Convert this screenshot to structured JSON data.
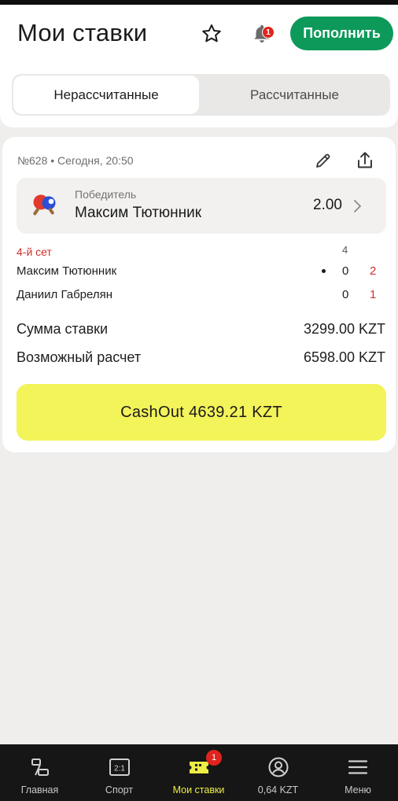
{
  "header": {
    "title": "Мои ставки",
    "notification_count": "1",
    "topup_label": "Пополнить",
    "icons": [
      "star-icon",
      "bell-icon"
    ]
  },
  "tabs": [
    {
      "label": "Нерассчитанные",
      "active": true
    },
    {
      "label": "Рассчитанные",
      "active": false
    }
  ],
  "bet": {
    "meta": "№628 • Сегодня, 20:50",
    "selection": {
      "market": "Победитель",
      "name": "Максим Тютюнник",
      "odds": "2.00",
      "sport_icon": "table-tennis-icon"
    },
    "score": {
      "set_label": "4-й сет",
      "column_header": "4",
      "rows": [
        {
          "player": "Максим Тютюнник",
          "current": "0",
          "sets": "2",
          "serving": true
        },
        {
          "player": "Даниил Габрелян",
          "current": "0",
          "sets": "1",
          "serving": false
        }
      ]
    },
    "stake_label": "Сумма ставки",
    "stake_value": "3299.00 KZT",
    "payout_label": "Возможный расчет",
    "payout_value": "6598.00 KZT",
    "cashout_label": "CashOut 4639.21 KZT"
  },
  "bottom_nav": {
    "items": [
      {
        "label": "Главная",
        "icon": "home-icon"
      },
      {
        "label": "Спорт",
        "icon": "scoreboard-icon",
        "icon_text": "2:1"
      },
      {
        "label": "Мои ставки",
        "icon": "ticket-icon",
        "active": true,
        "badge": "1"
      },
      {
        "label": "0,64 KZT",
        "icon": "account-icon"
      },
      {
        "label": "Меню",
        "icon": "menu-icon"
      }
    ]
  },
  "colors": {
    "accent_green": "#0d9959",
    "cashout_yellow": "#f3f35a",
    "live_red": "#d0302a",
    "nav_active": "#eded45",
    "badge_red": "#e0241d"
  }
}
